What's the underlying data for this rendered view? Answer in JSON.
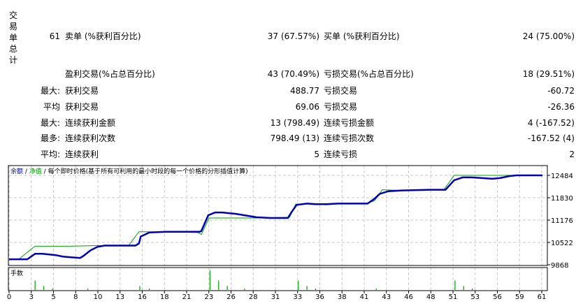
{
  "summary": {
    "vertical_label": [
      "交",
      "易",
      "单",
      "总",
      "计"
    ],
    "rows": [
      {
        "c0": "61",
        "c1": "卖单 (%获利百分比)",
        "c2": "37 (67.57%)",
        "c3": "买单 (%获利百分比)",
        "c4": "24 (75.00%)"
      },
      {
        "c0": "",
        "c1": "盈利交易(%占总百分比)",
        "c2": "43 (70.49%)",
        "c3": "亏损交易(%占总百分比)",
        "c4": "18 (29.51%)"
      },
      {
        "c0": "最大:",
        "c1": "获利交易",
        "c2": "488.77",
        "c3": "亏损交易",
        "c4": "-60.72"
      },
      {
        "c0": "平均",
        "c1": "获利交易",
        "c2": "69.06",
        "c3": "亏损交易",
        "c4": "-26.36"
      },
      {
        "c0": "最大:",
        "c1": "连续获利金额",
        "c2": "13 (798.49)",
        "c3": "连续亏损金额",
        "c4": "4 (-167.52)"
      },
      {
        "c0": "最多:",
        "c1": "连续获利次数",
        "c2": "798.49 (13)",
        "c3": "连续亏损次数",
        "c4": "-167.52 (4)"
      },
      {
        "c0": "平均:",
        "c1": "连续获利",
        "c2": "5",
        "c3": "连续亏损",
        "c4": "2"
      }
    ]
  },
  "chart_data": [
    {
      "type": "line",
      "title_parts": {
        "balance": "余额",
        "sep1": " / ",
        "equity": "净值",
        "sep2": " / ",
        "rest": "每个即时价格(基于所有可利用的最小时段的每一个价格的分形插值计算)"
      },
      "colors": {
        "balance": "#0000b4",
        "equity": "#00a000",
        "grid": "#c8c8c8"
      },
      "grid": true,
      "xlim": [
        0,
        61.6
      ],
      "ylim": [
        9868,
        12700
      ],
      "x_ticks": [
        "0",
        "3",
        "5",
        "8",
        "10",
        "13",
        "16",
        "18",
        "21",
        "23",
        "26",
        "28",
        "31",
        "33",
        "36",
        "38",
        "41",
        "43",
        "46",
        "48",
        "51",
        "53",
        "56",
        "59",
        "61"
      ],
      "y_ticks": [
        9868,
        10522,
        11176,
        11830,
        12484
      ],
      "series": [
        {
          "name": "余额",
          "key": "balance",
          "points": [
            [
              0,
              10029
            ],
            [
              2.1,
              10029
            ],
            [
              3.0,
              10190
            ],
            [
              3.9,
              10190
            ],
            [
              5.4,
              10150
            ],
            [
              6.2,
              10110
            ],
            [
              7.0,
              10090
            ],
            [
              8.2,
              10069
            ],
            [
              8.6,
              10130
            ],
            [
              9.4,
              10290
            ],
            [
              10.2,
              10391
            ],
            [
              11.0,
              10431
            ],
            [
              14.6,
              10431
            ],
            [
              15.0,
              10491
            ],
            [
              15.2,
              10693
            ],
            [
              16.2,
              10813
            ],
            [
              18.2,
              10834
            ],
            [
              22.0,
              10834
            ],
            [
              22.2,
              10854
            ],
            [
              23.0,
              11317
            ],
            [
              23.8,
              11398
            ],
            [
              24.6,
              11398
            ],
            [
              26.2,
              11357
            ],
            [
              28.6,
              11257
            ],
            [
              30.2,
              11237
            ],
            [
              32.2,
              11237
            ],
            [
              32.6,
              11398
            ],
            [
              33.2,
              11619
            ],
            [
              34.4,
              11659
            ],
            [
              35.4,
              11639
            ],
            [
              36.6,
              11639
            ],
            [
              38.0,
              11659
            ],
            [
              41.4,
              11659
            ],
            [
              42.2,
              11800
            ],
            [
              42.8,
              11941
            ],
            [
              43.8,
              12021
            ],
            [
              45.4,
              12042
            ],
            [
              48.6,
              12062
            ],
            [
              50.4,
              12062
            ],
            [
              51.4,
              12343
            ],
            [
              52.4,
              12424
            ],
            [
              53.4,
              12424
            ],
            [
              55.8,
              12384
            ],
            [
              56.7,
              12404
            ],
            [
              57.8,
              12464
            ],
            [
              58.6,
              12484
            ],
            [
              61.6,
              12484
            ]
          ]
        },
        {
          "name": "净值",
          "key": "equity",
          "points": [
            [
              0,
              10029
            ],
            [
              1.1,
              10029
            ],
            [
              3.0,
              10411
            ],
            [
              7.0,
              10411
            ],
            [
              10.2,
              10431
            ],
            [
              13.8,
              10431
            ],
            [
              15.0,
              10834
            ],
            [
              15.8,
              10834
            ],
            [
              21.8,
              10814
            ],
            [
              22.2,
              10753
            ],
            [
              23.1,
              11237
            ],
            [
              24.6,
              11237
            ],
            [
              29.4,
              11237
            ],
            [
              32.4,
              11257
            ],
            [
              33.1,
              11639
            ],
            [
              35.4,
              11659
            ],
            [
              36.6,
              11619
            ],
            [
              38.2,
              11659
            ],
            [
              41.2,
              11659
            ],
            [
              42.2,
              11740
            ],
            [
              43.1,
              12062
            ],
            [
              45.4,
              12042
            ],
            [
              50.2,
              12062
            ],
            [
              51.4,
              12484
            ],
            [
              55.0,
              12484
            ],
            [
              61.6,
              12484
            ]
          ]
        }
      ]
    },
    {
      "type": "bar",
      "label": "手数",
      "color": "#00a000",
      "ylim": [
        0,
        1
      ],
      "x": [
        3.0,
        4.0,
        5.0,
        9.1,
        15.1,
        16.2,
        23.2,
        24.2,
        25.2,
        27.2,
        33.4,
        34.4,
        35.4,
        42.4,
        51.5,
        52.5,
        53.5
      ],
      "values": [
        0.48,
        0.2,
        0.07,
        0.07,
        0.2,
        0.07,
        1.0,
        0.48,
        0.2,
        0.07,
        0.48,
        0.2,
        0.07,
        0.07,
        0.48,
        0.2,
        0.07
      ]
    }
  ]
}
